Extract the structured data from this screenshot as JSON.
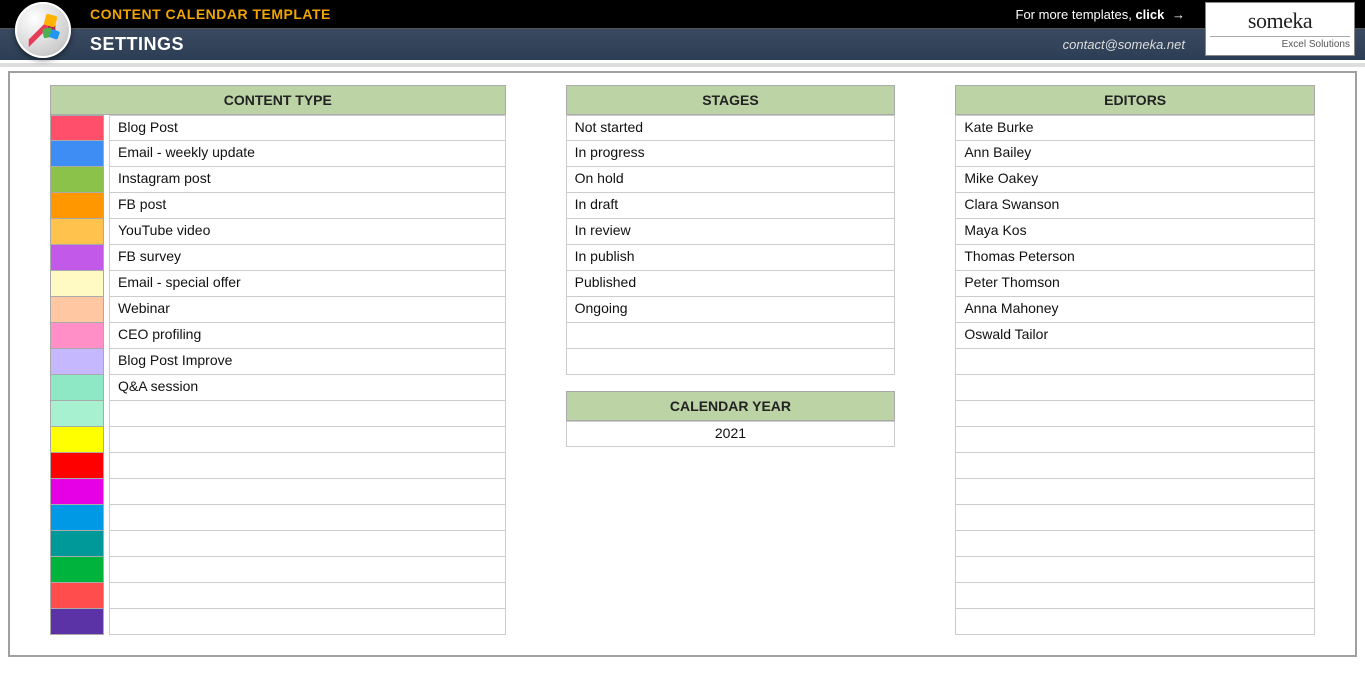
{
  "header": {
    "appTitle": "CONTENT CALENDAR TEMPLATE",
    "templatesText": "For more templates, ",
    "templatesClick": "click",
    "arrowGlyph": "→",
    "sectionTitle": "SETTINGS",
    "contactEmail": "contact@someka.net",
    "brandName": "someka",
    "brandSub": "Excel Solutions"
  },
  "contentType": {
    "title": "CONTENT TYPE",
    "rows": [
      {
        "color": "#ff4f6b",
        "label": "Blog Post"
      },
      {
        "color": "#3d8df5",
        "label": "Email - weekly update"
      },
      {
        "color": "#8bc34a",
        "label": "Instagram post"
      },
      {
        "color": "#ff9800",
        "label": "FB post"
      },
      {
        "color": "#ffc34d",
        "label": "YouTube video"
      },
      {
        "color": "#c259e8",
        "label": "FB survey"
      },
      {
        "color": "#fff9c4",
        "label": "Email - special offer"
      },
      {
        "color": "#ffc8a2",
        "label": "Webinar"
      },
      {
        "color": "#ff8fc6",
        "label": "CEO profiling"
      },
      {
        "color": "#c5b8ff",
        "label": "Blog Post Improve"
      },
      {
        "color": "#8fe8c5",
        "label": "Q&A session"
      },
      {
        "color": "#a7f0d0",
        "label": ""
      },
      {
        "color": "#ffff00",
        "label": ""
      },
      {
        "color": "#ff0000",
        "label": ""
      },
      {
        "color": "#e600e6",
        "label": ""
      },
      {
        "color": "#0099e6",
        "label": ""
      },
      {
        "color": "#009999",
        "label": ""
      },
      {
        "color": "#00b33c",
        "label": ""
      },
      {
        "color": "#ff4d4d",
        "label": ""
      },
      {
        "color": "#5c33a6",
        "label": ""
      }
    ]
  },
  "stages": {
    "title": "STAGES",
    "rows": [
      "Not started",
      "In progress",
      "On hold",
      "In draft",
      "In review",
      "In publish",
      "Published",
      "Ongoing",
      "",
      ""
    ]
  },
  "calendarYear": {
    "title": "CALENDAR YEAR",
    "value": "2021"
  },
  "editors": {
    "title": "EDITORS",
    "rows": [
      "Kate Burke",
      "Ann Bailey",
      "Mike Oakey",
      "Clara Swanson",
      "Maya Kos",
      "Thomas Peterson",
      "Peter Thomson",
      "Anna Mahoney",
      "Oswald Tailor",
      "",
      "",
      "",
      "",
      "",
      "",
      "",
      "",
      "",
      "",
      ""
    ]
  }
}
